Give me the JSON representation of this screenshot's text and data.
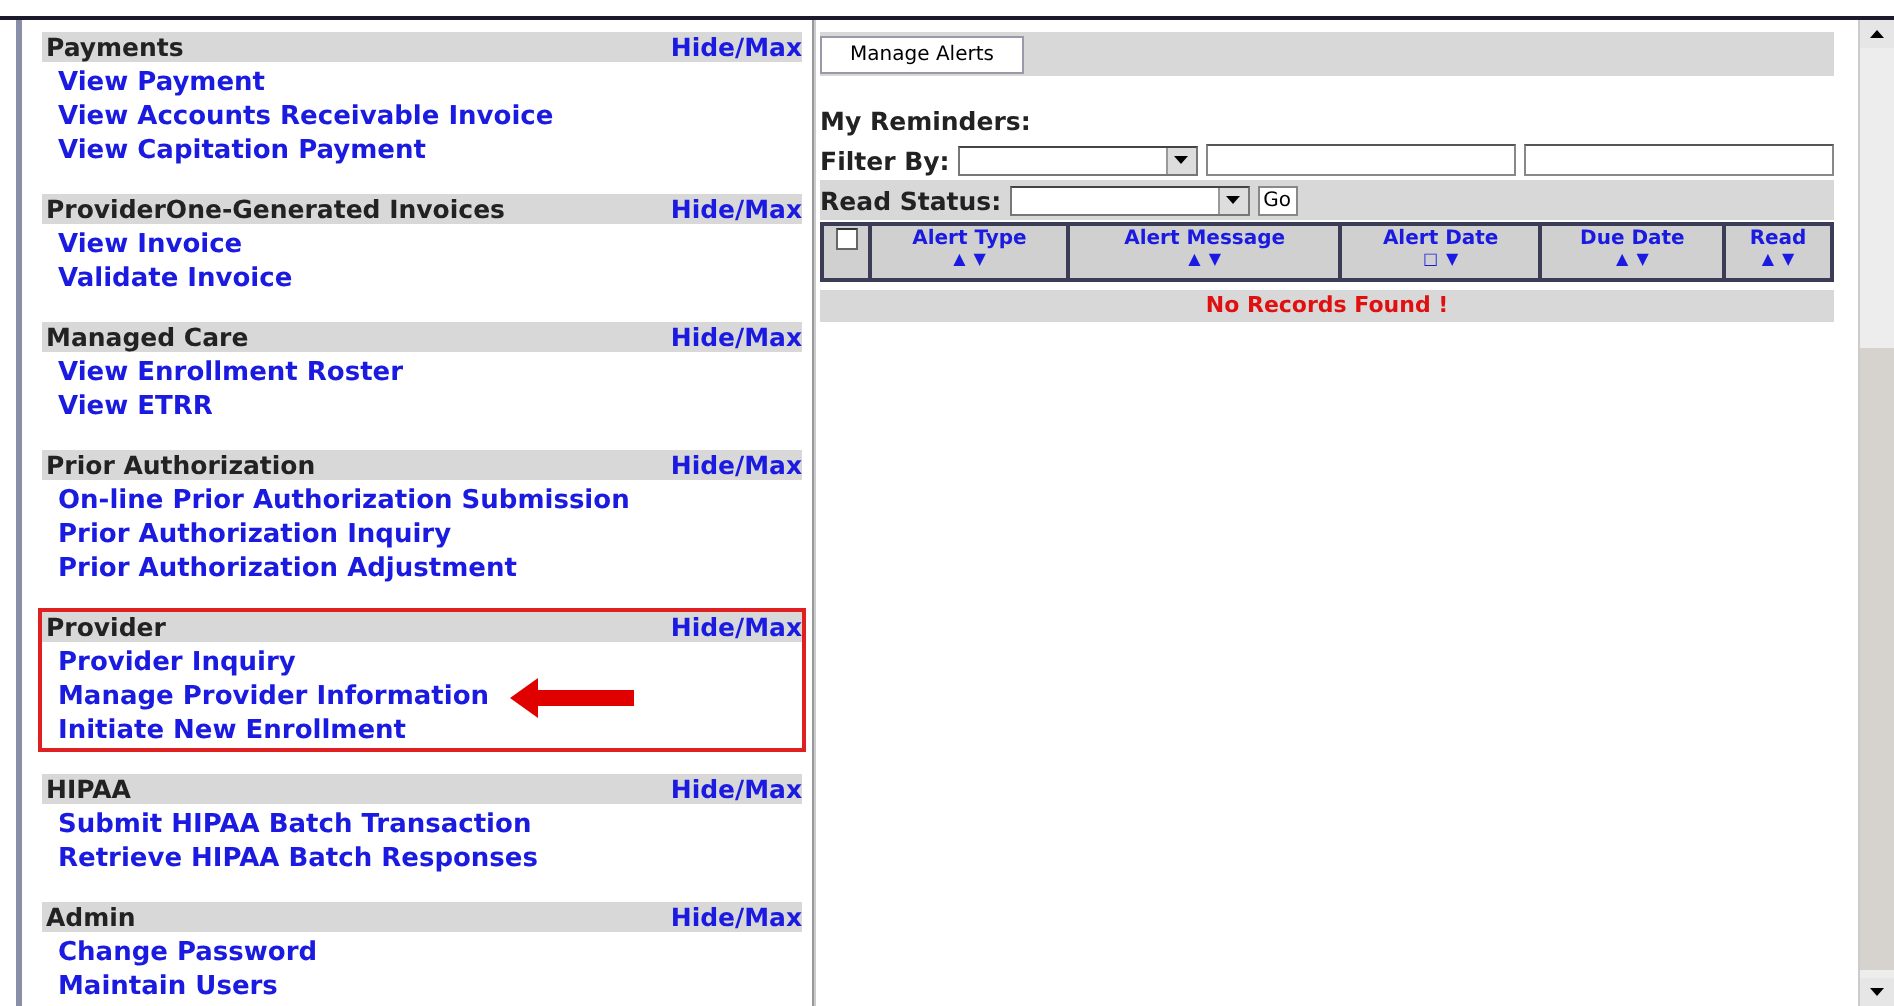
{
  "sections": [
    {
      "title": "Payments",
      "toggle": "Hide/Max",
      "highlighted": false,
      "links": [
        "View Payment",
        "View Accounts Receivable Invoice",
        "View Capitation Payment"
      ]
    },
    {
      "title": "ProviderOne-Generated Invoices",
      "toggle": "Hide/Max",
      "highlighted": false,
      "links": [
        "View Invoice",
        "Validate Invoice"
      ]
    },
    {
      "title": "Managed Care",
      "toggle": "Hide/Max",
      "highlighted": false,
      "links": [
        "View Enrollment Roster",
        "View ETRR"
      ]
    },
    {
      "title": "Prior Authorization",
      "toggle": "Hide/Max",
      "highlighted": false,
      "links": [
        "On-line Prior Authorization Submission",
        "Prior Authorization Inquiry",
        "Prior Authorization Adjustment"
      ]
    },
    {
      "title": "Provider",
      "toggle": "Hide/Max",
      "highlighted": true,
      "arrow_links": [
        {
          "label": "Provider Inquiry",
          "pointed_at": false
        },
        {
          "label": "Manage Provider Information",
          "pointed_at": true
        },
        {
          "label": "Initiate New Enrollment",
          "pointed_at": false
        }
      ]
    },
    {
      "title": "HIPAA",
      "toggle": "Hide/Max",
      "highlighted": false,
      "links": [
        "Submit HIPAA Batch Transaction",
        "Retrieve HIPAA Batch Responses"
      ]
    },
    {
      "title": "Admin",
      "toggle": "Hide/Max",
      "highlighted": false,
      "links": [
        "Change Password",
        "Maintain Users"
      ]
    }
  ],
  "alerts": {
    "tab": "Manage Alerts",
    "reminders_label": "My Reminders:",
    "filter_label": "Filter By:",
    "read_status_label": "Read Status:",
    "go_button": "Go",
    "select_all_checked": false,
    "columns": [
      {
        "label": "Alert Type",
        "sort_marks": [
          "▲",
          "▼"
        ]
      },
      {
        "label": "Alert Message",
        "sort_marks": [
          "▲",
          "▼"
        ]
      },
      {
        "label": "Alert Date",
        "sort_marks": [
          "□",
          "▼"
        ]
      },
      {
        "label": "Due Date",
        "sort_marks": [
          "▲",
          "▼"
        ]
      },
      {
        "label": "Read",
        "sort_marks": [
          "▲",
          "▼"
        ]
      }
    ],
    "empty_message": "No Records Found !"
  }
}
